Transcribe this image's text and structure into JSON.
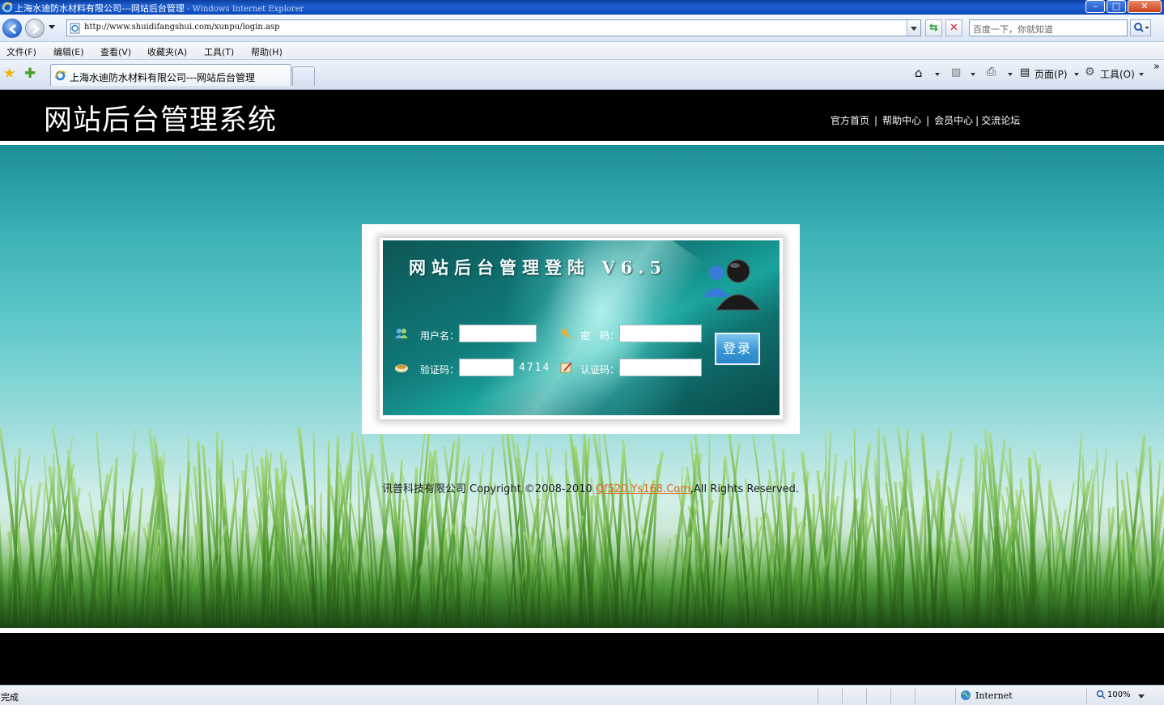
{
  "window": {
    "title": "上海水迪防水材料有限公司---网站后台管理",
    "title_suffix": " - Windows Internet Explorer",
    "minimize": "–",
    "maximize": "□",
    "close": "✕"
  },
  "address_bar": {
    "url": "http://www.shuidifangshui.com/xunpu/login.asp",
    "search_placeholder": "百度一下，你就知道",
    "refresh_icon": "refresh-icon",
    "stop_icon": "stop-icon"
  },
  "menu": [
    {
      "label": "文件(F)"
    },
    {
      "label": "编辑(E)"
    },
    {
      "label": "查看(V)"
    },
    {
      "label": "收藏夹(A)"
    },
    {
      "label": "工具(T)"
    },
    {
      "label": "帮助(H)"
    }
  ],
  "tab": {
    "title": "上海水迪防水材料有限公司---网站后台管理"
  },
  "command_bar": {
    "page_label": "页面(P)",
    "tools_label": "工具(O)",
    "chevron": "»"
  },
  "site": {
    "title": "网站后台管理系统",
    "links": [
      "官方首页",
      "帮助中心",
      "会员中心",
      "交流论坛"
    ],
    "separator": "|"
  },
  "login": {
    "title": "网站后台管理登陆 V6.5",
    "username_label": "用户名：",
    "password_label": "密　码：",
    "captcha_label": "验证码：",
    "auth_label": "认证码：",
    "captcha_code": "4714",
    "submit_label": "登录",
    "username_value": "",
    "password_value": "",
    "captcha_value": "",
    "auth_value": ""
  },
  "footer": {
    "company": "讯普科技有限公司",
    "copyright": "  Copyright ©2008-2010 ",
    "link": "Qf520.Ys168.Com",
    "rights": ",All Rights Reserved."
  },
  "status_bar": {
    "status": "完成",
    "zone": "Internet",
    "zoom": "100%"
  },
  "colors": {
    "header_bg": "#000000",
    "link_orange": "#e0661a",
    "teal_bg": "#3ab1b6"
  }
}
